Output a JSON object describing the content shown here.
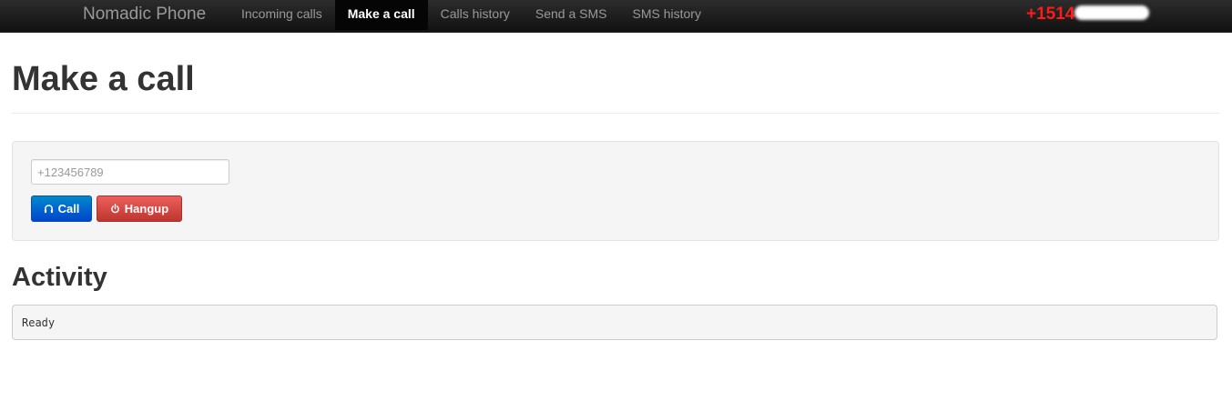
{
  "navbar": {
    "brand": "Nomadic Phone",
    "items": [
      {
        "label": "Incoming calls",
        "active": false
      },
      {
        "label": "Make a call",
        "active": true
      },
      {
        "label": "Calls history",
        "active": false
      },
      {
        "label": "Send a SMS",
        "active": false
      },
      {
        "label": "SMS history",
        "active": false
      }
    ],
    "phone_number": "+1514",
    "phone_number_color": "#ff1a1a"
  },
  "page": {
    "title": "Make a call"
  },
  "call_form": {
    "number_value": "",
    "number_placeholder": "+123456789",
    "call_button": {
      "label": "Call",
      "icon": "headphones-icon",
      "color": "#0055cc"
    },
    "hangup_button": {
      "label": "Hangup",
      "icon": "power-icon",
      "color": "#d9413a"
    }
  },
  "activity": {
    "title": "Activity",
    "log": "Ready"
  }
}
